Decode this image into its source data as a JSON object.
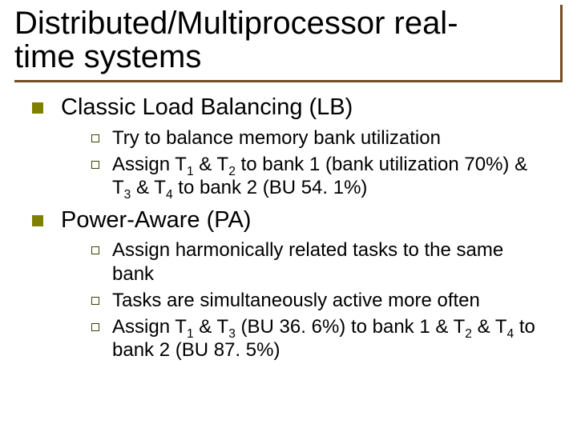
{
  "title_line1": "Distributed/Multiprocessor real-",
  "title_line2": "time systems",
  "s1": {
    "h": "Classic Load Balancing (LB)",
    "a": "Try to balance memory bank utilization",
    "b_pre": "Assign T",
    "b_mid1": " & T",
    "b_mid2": " to bank 1 (bank utilization 70%) & T",
    "b_mid3": " & T",
    "b_post": " to bank 2 (BU 54. 1%)"
  },
  "s2": {
    "h": "Power-Aware (PA)",
    "a": "Assign harmonically related tasks to the same bank",
    "b": "Tasks are simultaneously active more often",
    "c_pre": "Assign T",
    "c_mid1": " & T",
    "c_mid2": " (BU 36. 6%) to bank 1 & T",
    "c_mid3": " & T",
    "c_post": " to bank 2 (BU 87. 5%)"
  },
  "sub": {
    "one": "1",
    "two": "2",
    "three": "3",
    "four": "4"
  }
}
